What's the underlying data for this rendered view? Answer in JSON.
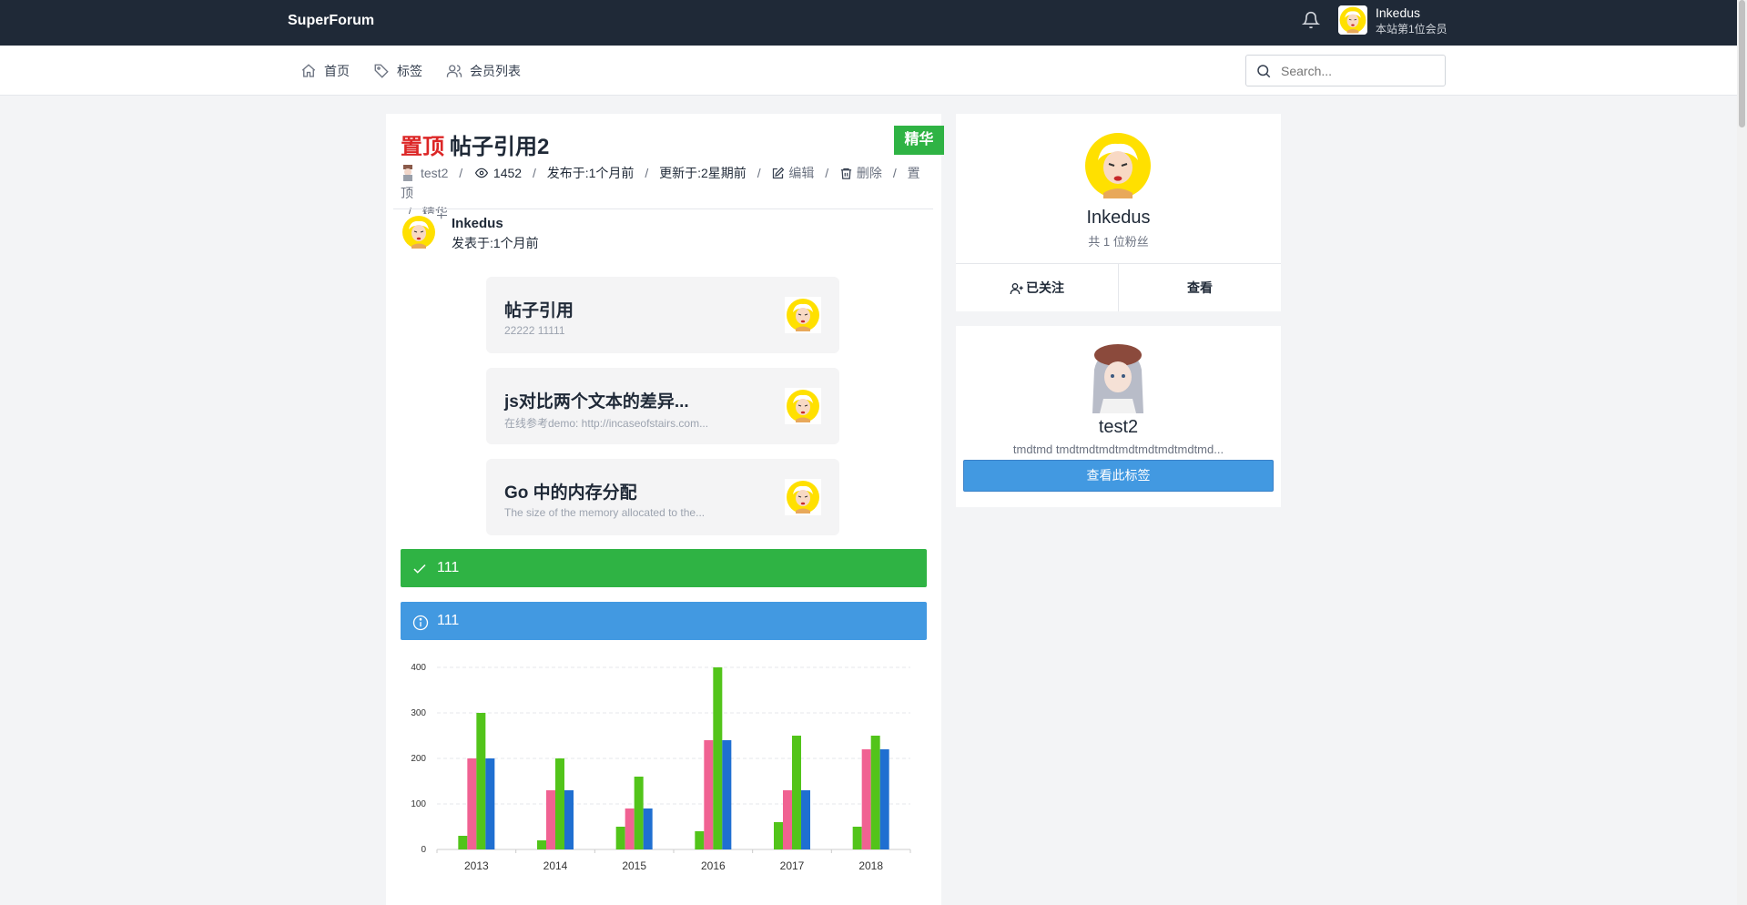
{
  "header": {
    "brand": "SuperForum",
    "user_name": "Inkedus",
    "user_rank": "本站第1位会员"
  },
  "nav": {
    "items": [
      {
        "label": "首页",
        "icon": "home-icon"
      },
      {
        "label": "标签",
        "icon": "tag-icon"
      },
      {
        "label": "会员列表",
        "icon": "users-icon"
      }
    ],
    "search_placeholder": "Search..."
  },
  "post": {
    "pinned_label": "置顶",
    "title": "帖子引用2",
    "badge": "精华",
    "author": "test2",
    "views": "1452",
    "published": "发布于:1个月前",
    "updated": "更新于:2星期前",
    "actions": [
      "编辑",
      "删除",
      "置顶",
      "精华"
    ]
  },
  "reply": {
    "name": "Inkedus",
    "time": "发表于:1个月前"
  },
  "references": [
    {
      "title": "帖子引用",
      "desc": "22222 11111"
    },
    {
      "title": "js对比两个文本的差异...",
      "desc": "在线参考demo:   http://incaseofstairs.com..."
    },
    {
      "title": "Go 中的内存分配",
      "desc": "The size of the memory allocated to the..."
    }
  ],
  "alerts": {
    "success": "111",
    "info": "111"
  },
  "chart_data": {
    "type": "bar",
    "categories": [
      "2013",
      "2014",
      "2015",
      "2016",
      "2017",
      "2018"
    ],
    "series": [
      {
        "values": [
          30,
          20,
          50,
          40,
          60,
          50
        ],
        "color": "#52c41a"
      },
      {
        "values": [
          200,
          130,
          90,
          240,
          130,
          220
        ],
        "color": "#f06292"
      },
      {
        "values": [
          300,
          200,
          160,
          400,
          250,
          250
        ],
        "color": "#52c41a"
      },
      {
        "values": [
          200,
          130,
          90,
          240,
          130,
          220
        ],
        "color": "#1f6fd1"
      }
    ],
    "yticks": [
      "0",
      "100",
      "200",
      "300",
      "400"
    ],
    "ylim": [
      0,
      400
    ],
    "grid": true
  },
  "profile": {
    "name": "Inkedus",
    "fans": "共 1 位粉丝",
    "follow_label": "已关注",
    "view_label": "查看"
  },
  "tag": {
    "name": "test2",
    "desc": "tmdtmd tmdtmdtmdtmdtmdtmdtmdtmd...",
    "button": "查看此标签"
  },
  "colors": {
    "topbar": "#1f2937",
    "pinned": "#dc2626",
    "success": "#2fb344",
    "info": "#4299e1"
  }
}
